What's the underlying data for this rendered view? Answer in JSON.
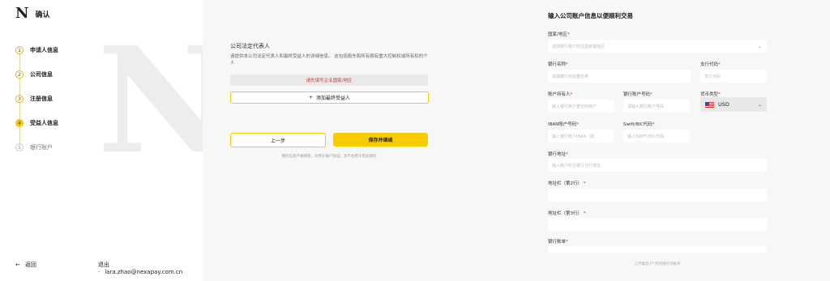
{
  "brand": {
    "logo": "N",
    "title": "确认"
  },
  "watermark": "N",
  "steps": [
    {
      "num": "1",
      "label": "申请人信息"
    },
    {
      "num": "2",
      "label": "公司信息"
    },
    {
      "num": "3",
      "label": "注册信息"
    },
    {
      "num": "4",
      "label": "受益人信息"
    },
    {
      "num": "5",
      "label": "银行账户"
    }
  ],
  "footer": {
    "back_icon": "←",
    "back_label": "返回",
    "logout_label": "退出",
    "separator": "·",
    "email": "lara.zhao@nexapay.com.cn"
  },
  "rep": {
    "title": "公司法定代表人",
    "desc": "请提供本公司法定代表人和最终受益人的详细信息。 这包括股东和所有拥有重大控制权或所有权的个人",
    "warning": "请先填写企业国家/地区",
    "add_icon": "+",
    "add_label": "添加最终受益人",
    "prev_label": "上一步",
    "next_label": "保存并继续",
    "fine_print": "我的信息严格保密，仅用于账户验证，多不会用于其他目的"
  },
  "form": {
    "title": "输入公司账户信息以便顺利交易",
    "country": {
      "label": "国家/地区",
      "placeholder": "选择银行账户所在国家或地区",
      "chevron": "⌄"
    },
    "bank_name": {
      "label": "银行名称",
      "placeholder": "请填银行的完整名称"
    },
    "branch_code": {
      "label": "支行代码",
      "placeholder": "支行代码"
    },
    "holder": {
      "label": "账户持有人",
      "placeholder": "输入银行账户登记的用户"
    },
    "account_no": {
      "label": "银行账户号码",
      "placeholder": "请输入银行账户号码"
    },
    "currency": {
      "label": "货币类型",
      "value": "USD",
      "chevron": "⌄"
    },
    "iban": {
      "label": "IBAN账户号码",
      "placeholder": "输入银行账户IBAN（如…"
    },
    "swift": {
      "label": "Swift/BIC代码",
      "placeholder": "输入SWIFT/BIC代码"
    },
    "address": {
      "label": "银行地址",
      "placeholder": "输入账户所在银行分行地址"
    },
    "address2": {
      "label": "地址栏（第2行）",
      "placeholder": ""
    },
    "address3": {
      "label": "地址栏（第3行）",
      "placeholder": ""
    },
    "statement": {
      "label": "银行账单"
    },
    "footer_note": "上传最近3个月的银行对账单",
    "required_mark": "*"
  }
}
